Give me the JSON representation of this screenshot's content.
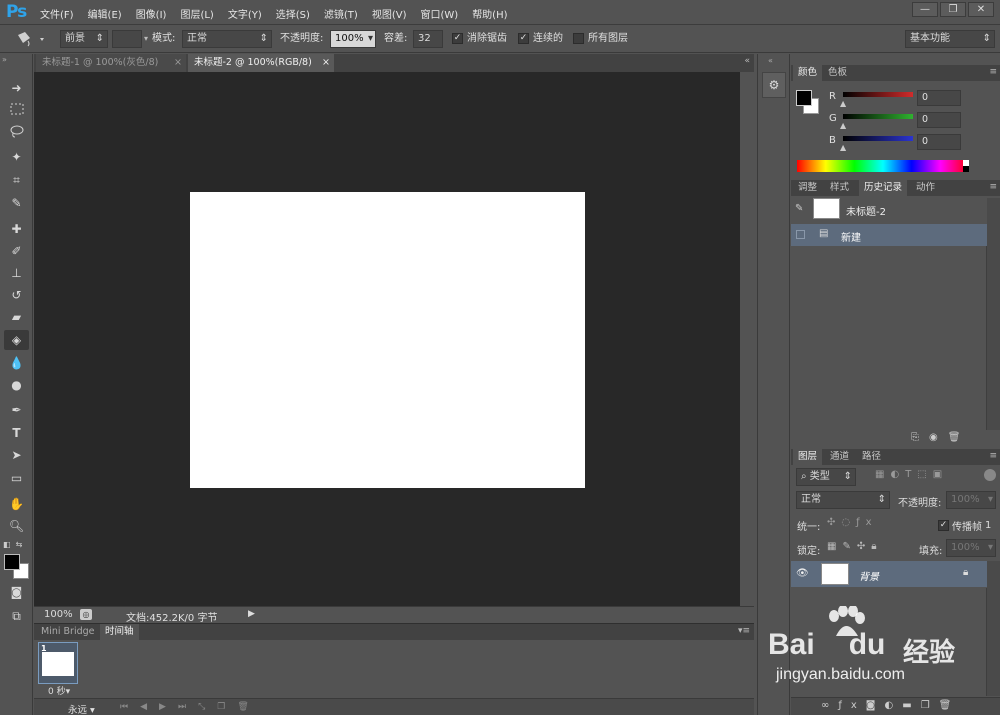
{
  "app": {
    "logo": "Ps",
    "menus": [
      "文件(F)",
      "编辑(E)",
      "图像(I)",
      "图层(L)",
      "文字(Y)",
      "选择(S)",
      "滤镜(T)",
      "视图(V)",
      "窗口(W)",
      "帮助(H)"
    ],
    "window_controls": [
      "—",
      "❐",
      "✕"
    ]
  },
  "options": {
    "fill_source": "前景",
    "mode_label": "模式:",
    "mode_value": "正常",
    "opacity_label": "不透明度:",
    "opacity_value": "100%",
    "tolerance_label": "容差:",
    "tolerance_value": "32",
    "antialias_label": "消除锯齿",
    "contiguous_label": "连续的",
    "all_layers_label": "所有图层",
    "workspace": "基本功能"
  },
  "documents": {
    "tabs": [
      {
        "label": "未标题-1 @ 100%(灰色/8)",
        "close": "×",
        "active": false
      },
      {
        "label": "未标题-2 @ 100%(RGB/8)",
        "close": "×",
        "active": true
      }
    ]
  },
  "status": {
    "zoom": "100%",
    "doc_info": "文档:452.2K/0 字节"
  },
  "bottom_panel": {
    "tabs": [
      "Mini Bridge",
      "时间轴"
    ],
    "frame_number": "1",
    "frame_delay": "0 秒▾",
    "loop": "永远"
  },
  "color_panel": {
    "tabs": [
      "颜色",
      "色板"
    ],
    "channels": [
      {
        "label": "R",
        "value": "0",
        "color": "#d12b2b"
      },
      {
        "label": "G",
        "value": "0",
        "color": "#2fb12f"
      },
      {
        "label": "B",
        "value": "0",
        "color": "#2b34d1"
      }
    ]
  },
  "history_panel": {
    "tabs": [
      "调整",
      "样式",
      "历史记录",
      "动作"
    ],
    "snapshot": "未标题-2",
    "items": [
      "新建"
    ]
  },
  "layers_panel": {
    "tabs": [
      "图层",
      "通道",
      "路径"
    ],
    "filter_label": "类型",
    "blend_mode": "正常",
    "opacity_label": "不透明度:",
    "opacity_value": "100%",
    "unify_label": "统一:",
    "propagate_label": "传播帧",
    "propagate_value": "1",
    "lock_label": "锁定:",
    "fill_label": "填充:",
    "fill_value": "100%",
    "layers": [
      {
        "name": "背景",
        "locked": true,
        "visible": true
      }
    ]
  },
  "watermark": {
    "brand": "Bai",
    "brand_tail": "du",
    "cn": "经验",
    "url": "jingyan.baidu.com"
  }
}
